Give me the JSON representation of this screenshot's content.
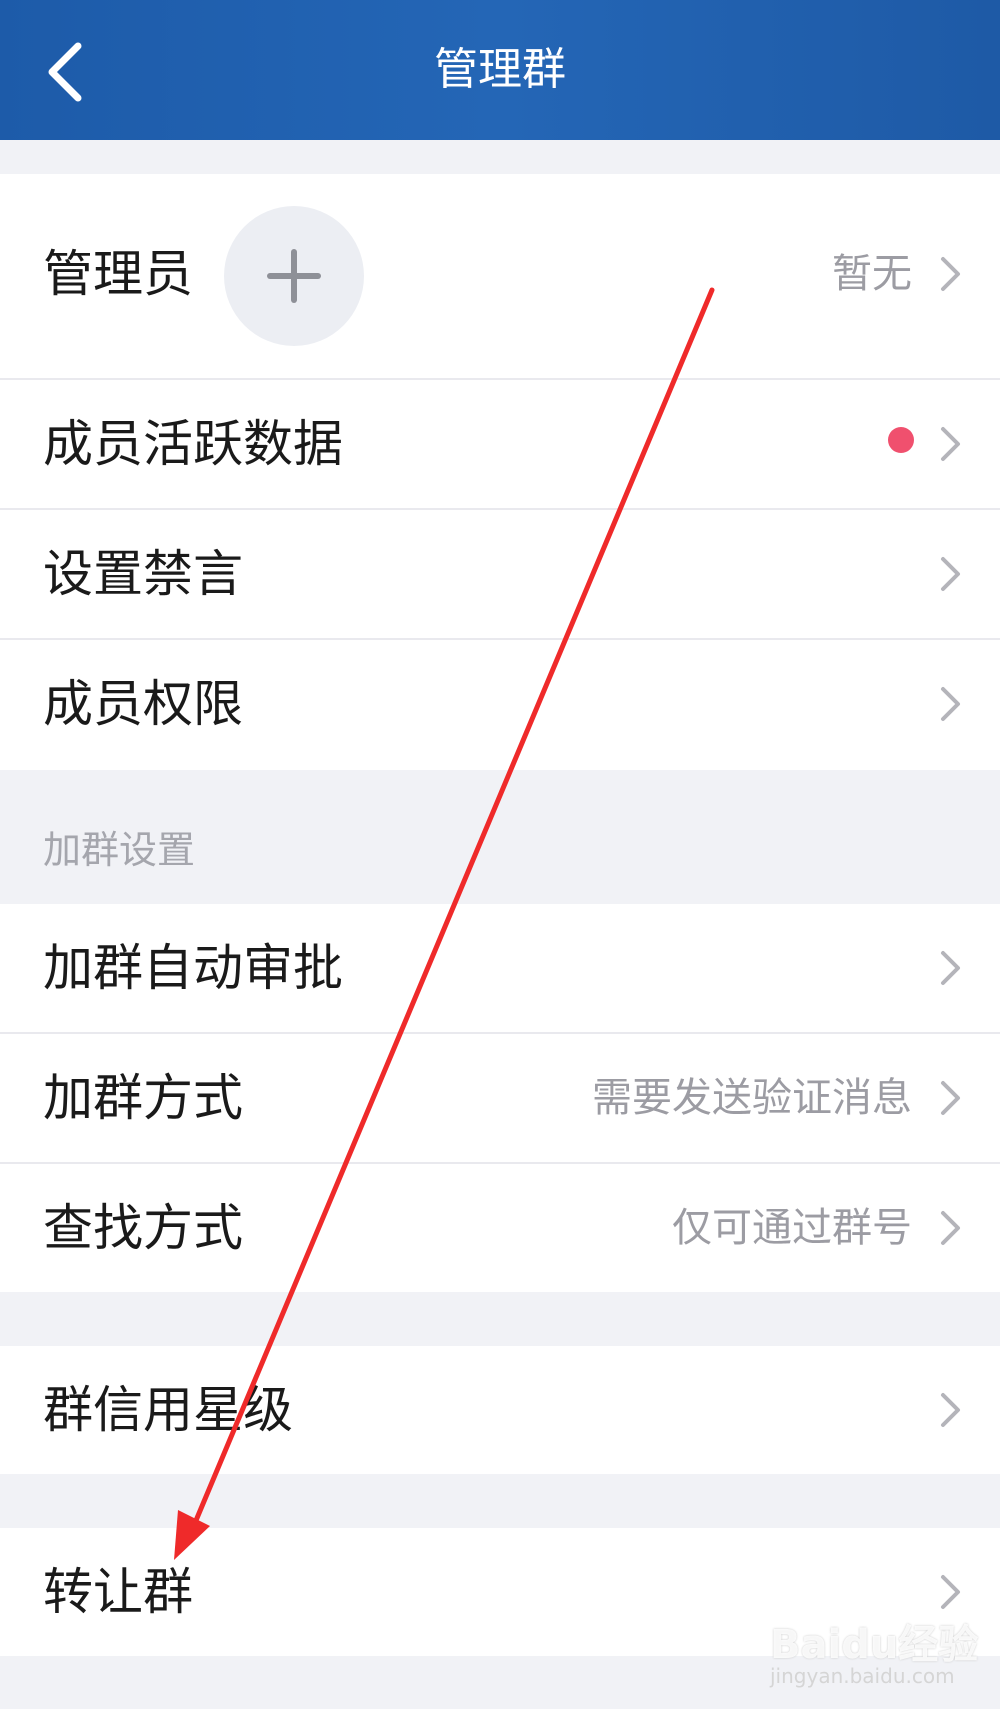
{
  "header": {
    "title": "管理群",
    "back_icon": "chevron-left-icon"
  },
  "admin_row": {
    "label": "管理员",
    "value": "暂无",
    "add_icon": "plus-icon"
  },
  "rows_group1": [
    {
      "label": "成员活跃数据",
      "has_badge": true,
      "badge_color": "#f0506e"
    },
    {
      "label": "设置禁言"
    },
    {
      "label": "成员权限"
    }
  ],
  "join_section": {
    "title": "加群设置",
    "rows": [
      {
        "label": "加群自动审批",
        "value": ""
      },
      {
        "label": "加群方式",
        "value": "需要发送验证消息"
      },
      {
        "label": "查找方式",
        "value": "仅可通过群号"
      }
    ]
  },
  "credit_row": {
    "label": "群信用星级"
  },
  "transfer_row": {
    "label": "转让群"
  },
  "annotation": {
    "arrow_color": "#ef2a2a"
  },
  "watermark": {
    "brand": "Baidu经验",
    "url": "jingyan.baidu.com"
  },
  "colors": {
    "header_blue": "#2262b2",
    "background": "#f1f2f6"
  }
}
